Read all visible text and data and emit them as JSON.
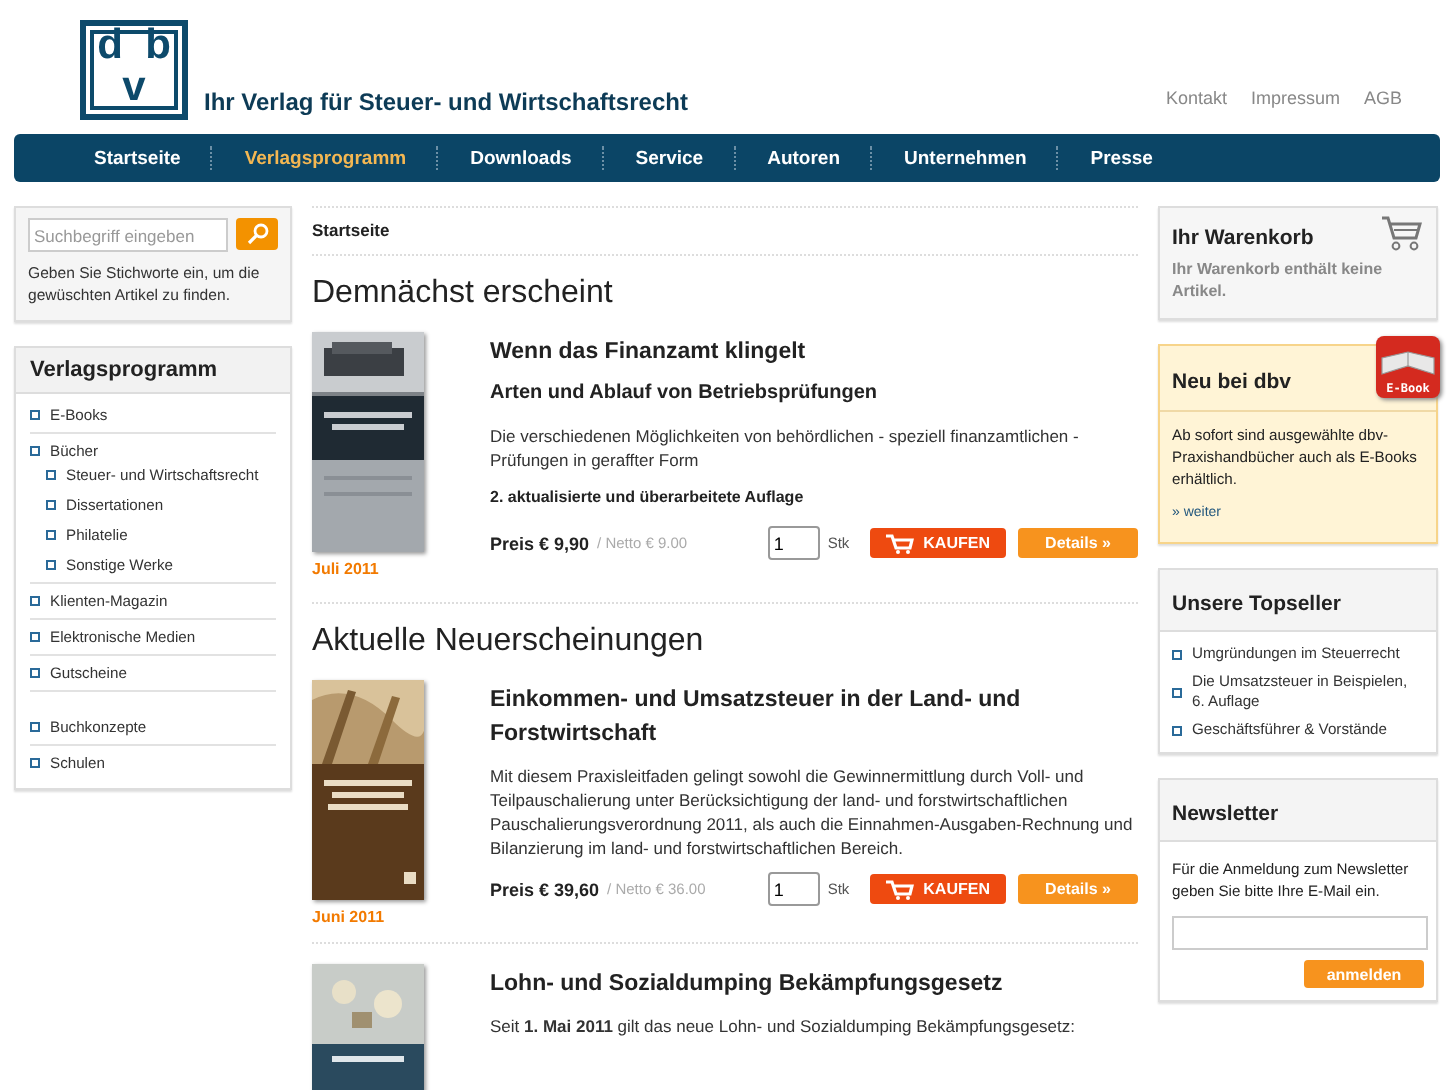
{
  "logo": {
    "letters": [
      "d",
      "b",
      "v"
    ]
  },
  "tagline": "Ihr Verlag für Steuer- und Wirtschaftsrecht",
  "top_links": [
    "Kontakt",
    "Impressum",
    "AGB"
  ],
  "nav": [
    {
      "label": "Startseite",
      "selected": false
    },
    {
      "label": "Verlagsprogramm",
      "selected": true
    },
    {
      "label": "Downloads",
      "selected": false
    },
    {
      "label": "Service",
      "selected": false
    },
    {
      "label": "Autoren",
      "selected": false
    },
    {
      "label": "Unternehmen",
      "selected": false
    },
    {
      "label": "Presse",
      "selected": false
    }
  ],
  "search": {
    "placeholder": "Suchbegriff eingeben",
    "hint": "Geben Sie Stichworte ein, um die gewüschten Artikel zu finden."
  },
  "sidebar": {
    "title": "Verlagsprogramm",
    "items": [
      {
        "label": "E-Books"
      },
      {
        "label": "Bücher",
        "children": [
          {
            "label": "Steuer- und Wirtschaftsrecht"
          },
          {
            "label": "Dissertationen"
          },
          {
            "label": "Philatelie"
          },
          {
            "label": "Sonstige Werke"
          }
        ]
      },
      {
        "label": "Klienten-Magazin"
      },
      {
        "label": "Elektronische Medien"
      },
      {
        "label": "Gutscheine"
      },
      {
        "label": "Buchkonzepte",
        "gap": true
      },
      {
        "label": "Schulen"
      }
    ]
  },
  "breadcrumb": "Startseite",
  "sections": [
    {
      "heading": "Demnächst erscheint",
      "products": [
        {
          "date": "Juli 2011",
          "title": "Wenn das Finanzamt klingelt",
          "subtitle": "Arten und Ablauf von Betriebsprüfungen",
          "description": "Die verschiedenen Möglichkeiten von behördlichen - speziell finanzamtlichen - Prüfungen in geraffter Form",
          "edition": "2. aktualisierte und überarbeitete Auflage",
          "price": "Preis € 9,90",
          "netto": "/ Netto € 9.00",
          "qty": "1",
          "unit": "Stk",
          "buy": "KAUFEN",
          "details": "Details »"
        }
      ]
    },
    {
      "heading": "Aktuelle Neuerscheinungen",
      "products": [
        {
          "date": "Juni 2011",
          "title": "Einkommen- und Umsatzsteuer in der Land- und Forstwirtschaft",
          "description": "Mit diesem Praxisleitfaden gelingt sowohl die Gewinnermittlung durch Voll- und Teilpauschalierung unter Berücksichtigung der land- und forstwirtschaftlichen Pauschalierungsverordnung 2011, als auch die Einnahmen-Ausgaben-Rechnung und Bilanzierung im land- und forstwirtschaftlichen Bereich.",
          "price": "Preis € 39,60",
          "netto": "/ Netto € 36.00",
          "qty": "1",
          "unit": "Stk",
          "buy": "KAUFEN",
          "details": "Details »"
        },
        {
          "title": "Lohn- und Sozialdumping Bekämpfungsgesetz",
          "description": "Seit **1. Mai 2011** gilt das neue Lohn- und Sozialdumping Bekämpfungsgesetz:"
        }
      ]
    }
  ],
  "cart": {
    "title": "Ihr Warenkorb",
    "text": "Ihr Warenkorb enthält keine Artikel."
  },
  "promo": {
    "title": "Neu bei dbv",
    "badge": "E-Book",
    "text": "Ab sofort sind ausgewählte dbv-Praxishandbücher auch als E-Books erhältlich.",
    "link": "» weiter"
  },
  "topseller": {
    "title": "Unsere Topseller",
    "items": [
      "Umgründungen im Steuerrecht",
      "Die Umsatzsteuer in Beispielen, 6. Auflage",
      "Geschäftsführer & Vorstände"
    ]
  },
  "newsletter": {
    "title": "Newsletter",
    "text": "Für die Anmeldung zum Newsletter geben Sie bitte Ihre E-Mail ein.",
    "button": "anmelden"
  }
}
